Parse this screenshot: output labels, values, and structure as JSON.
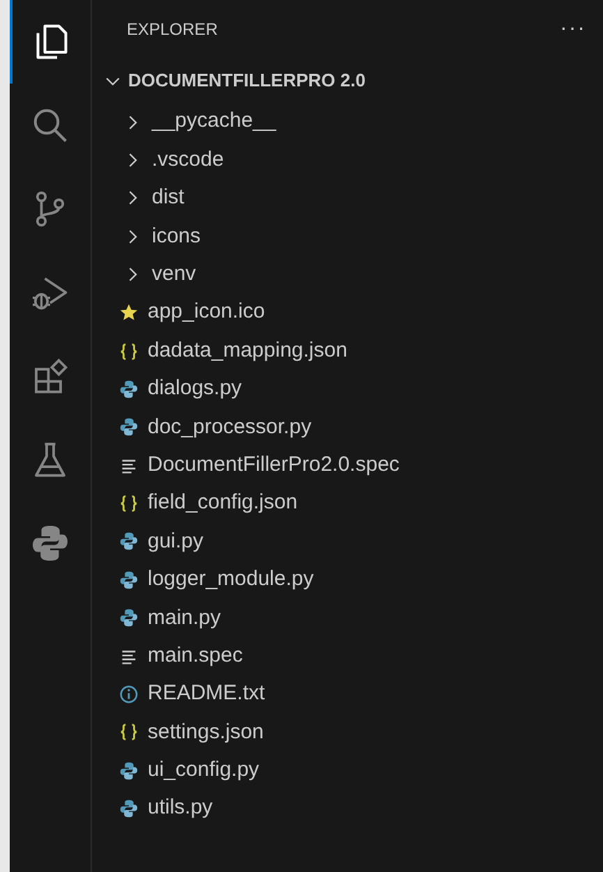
{
  "activity_bar": [
    {
      "selected": true
    },
    {
      "selected": false
    },
    {
      "selected": false
    },
    {
      "selected": false
    },
    {
      "selected": false
    },
    {
      "selected": false
    },
    {
      "selected": false
    }
  ],
  "explorer": {
    "title": "EXPLORER",
    "more": "···",
    "root": {
      "label": "DOCUMENTFILLERPRO 2.0",
      "expanded": true,
      "children": [
        {
          "label": "__pycache__",
          "kind": "folder",
          "expanded": false
        },
        {
          "label": ".vscode",
          "kind": "folder",
          "expanded": false
        },
        {
          "label": "dist",
          "kind": "folder",
          "expanded": false
        },
        {
          "label": "icons",
          "kind": "folder",
          "expanded": false
        },
        {
          "label": "venv",
          "kind": "folder",
          "expanded": false
        },
        {
          "label": "app_icon.ico",
          "kind": "ico"
        },
        {
          "label": "dadata_mapping.json",
          "kind": "json"
        },
        {
          "label": "dialogs.py",
          "kind": "python"
        },
        {
          "label": "doc_processor.py",
          "kind": "python"
        },
        {
          "label": "DocumentFillerPro2.0.spec",
          "kind": "spec"
        },
        {
          "label": "field_config.json",
          "kind": "json"
        },
        {
          "label": "gui.py",
          "kind": "python"
        },
        {
          "label": "logger_module.py",
          "kind": "python"
        },
        {
          "label": "main.py",
          "kind": "python"
        },
        {
          "label": "main.spec",
          "kind": "spec"
        },
        {
          "label": "README.txt",
          "kind": "readme"
        },
        {
          "label": "settings.json",
          "kind": "json"
        },
        {
          "label": "ui_config.py",
          "kind": "python"
        },
        {
          "label": "utils.py",
          "kind": "python"
        }
      ]
    }
  }
}
